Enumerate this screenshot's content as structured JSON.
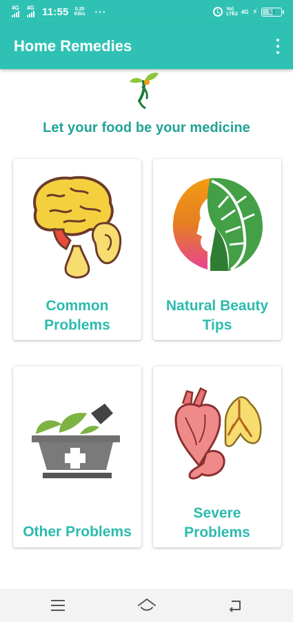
{
  "status_bar": {
    "network_1": "4G",
    "network_2": "4G",
    "time": "11:55",
    "speed_value": "0.20",
    "speed_unit": "KB/s",
    "more": "···",
    "volte_line1": "Vo)",
    "volte_line2": "LTE2",
    "network_right": "4G",
    "battery_level": "53",
    "battery_fraction": 0.53
  },
  "app_bar": {
    "title": "Home Remedies",
    "overflow_icon": "more-vert-icon"
  },
  "tagline": "Let your food be your medicine",
  "cards": [
    {
      "label_line1": "Common",
      "label_line2": "Problems",
      "icon": "brain-ear-nose-icon"
    },
    {
      "label_line1": "Natural Beauty",
      "label_line2": "Tips",
      "icon": "face-leaf-icon"
    },
    {
      "label": "Other Problems",
      "icon": "mortar-herbs-icon"
    },
    {
      "label_line1": "Severe",
      "label_line2": "Problems",
      "icon": "heart-lungs-icon"
    }
  ],
  "nav_bar": {
    "menu_icon": "menu-icon",
    "home_icon": "home-icon",
    "back_icon": "back-icon"
  },
  "colors": {
    "primary": "#2fc2b4",
    "tagline": "#1fa396",
    "card_label": "#2bbbae"
  }
}
